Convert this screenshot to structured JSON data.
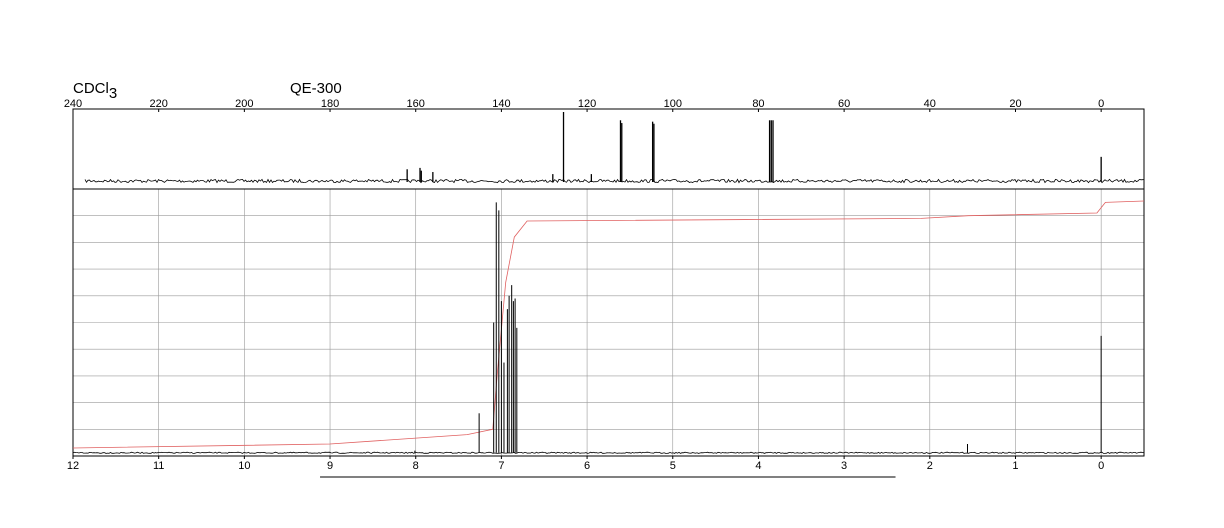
{
  "header": {
    "solvent": "CDCl",
    "solvent_subscript": "3",
    "instrument": "QE-300"
  },
  "chart_data": [
    {
      "type": "line",
      "name": "13C NMR spectrum",
      "x_axis_position": "top",
      "xlim": [
        240,
        -10
      ],
      "ticks": [
        240,
        220,
        200,
        180,
        160,
        140,
        120,
        100,
        80,
        60,
        40,
        20,
        0
      ],
      "tick_labels": [
        "240",
        "220",
        "200",
        "180",
        "160",
        "140",
        "120",
        "100",
        "80",
        "60",
        "40",
        "20",
        "0"
      ],
      "grid": false,
      "peaks": [
        {
          "x": 162.0,
          "h": 0.17
        },
        {
          "x": 159.0,
          "h": 0.19
        },
        {
          "x": 158.7,
          "h": 0.15
        },
        {
          "x": 156.0,
          "h": 0.13
        },
        {
          "x": 128.0,
          "h": 0.1
        },
        {
          "x": 125.5,
          "h": 1.0
        },
        {
          "x": 119.0,
          "h": 0.1
        },
        {
          "x": 112.2,
          "h": 0.88
        },
        {
          "x": 111.9,
          "h": 0.84
        },
        {
          "x": 104.7,
          "h": 0.86
        },
        {
          "x": 104.4,
          "h": 0.83
        },
        {
          "x": 77.4,
          "h": 0.88
        },
        {
          "x": 77.0,
          "h": 0.88
        },
        {
          "x": 76.6,
          "h": 0.88
        },
        {
          "x": 0.0,
          "h": 0.35
        }
      ]
    },
    {
      "type": "line",
      "name": "1H NMR spectrum",
      "x_axis_position": "bottom",
      "xlim": [
        12,
        -0.5
      ],
      "ticks": [
        12,
        11,
        10,
        9,
        8,
        7,
        6,
        5,
        4,
        3,
        2,
        1,
        0
      ],
      "tick_labels": [
        "12",
        "11",
        "10",
        "9",
        "8",
        "7",
        "6",
        "5",
        "4",
        "3",
        "2",
        "1",
        "0"
      ],
      "grid": true,
      "ylim": [
        0,
        10
      ],
      "peaks": [
        {
          "x": 7.26,
          "h": 1.6
        },
        {
          "x": 7.09,
          "h": 5.0
        },
        {
          "x": 7.06,
          "h": 9.5
        },
        {
          "x": 7.03,
          "h": 9.2
        },
        {
          "x": 7.0,
          "h": 5.8
        },
        {
          "x": 6.97,
          "h": 3.5
        },
        {
          "x": 6.93,
          "h": 5.5
        },
        {
          "x": 6.91,
          "h": 6.0
        },
        {
          "x": 6.88,
          "h": 6.4
        },
        {
          "x": 6.86,
          "h": 5.8
        },
        {
          "x": 6.84,
          "h": 5.9
        },
        {
          "x": 6.82,
          "h": 4.8
        },
        {
          "x": 8.01,
          "h": 0.2
        },
        {
          "x": 1.56,
          "h": 0.45
        },
        {
          "x": 0.0,
          "h": 4.5
        }
      ],
      "integral": [
        {
          "x": 12.0,
          "y": 0.3
        },
        {
          "x": 9.0,
          "y": 0.45
        },
        {
          "x": 7.4,
          "y": 0.8
        },
        {
          "x": 7.1,
          "y": 1.0
        },
        {
          "x": 7.05,
          "y": 3.0
        },
        {
          "x": 6.95,
          "y": 6.5
        },
        {
          "x": 6.85,
          "y": 8.2
        },
        {
          "x": 6.7,
          "y": 8.8
        },
        {
          "x": 2.1,
          "y": 8.9
        },
        {
          "x": 1.55,
          "y": 9.0
        },
        {
          "x": 0.05,
          "y": 9.1
        },
        {
          "x": -0.05,
          "y": 9.5
        },
        {
          "x": -0.5,
          "y": 9.55
        }
      ],
      "integral_color": "#e06060",
      "underline_range": [
        9.0,
        2.4
      ]
    }
  ]
}
